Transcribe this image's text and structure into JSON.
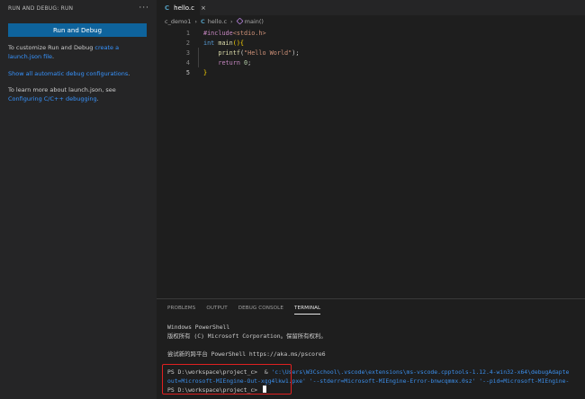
{
  "sidebar": {
    "title": "RUN AND DEBUG: RUN",
    "more_glyph": "···",
    "run_button": "Run and Debug",
    "customize_prefix": "To customize Run and Debug ",
    "customize_link": "create a launch.json file",
    "customize_suffix": ".",
    "show_all_link": "Show all automatic debug configurations",
    "show_all_suffix": ".",
    "learn_prefix": "To learn more about launch.json, see ",
    "learn_link": "Configuring C/C++ debugging",
    "learn_suffix": "."
  },
  "editor": {
    "tab": {
      "icon": "C",
      "label": "hello.c",
      "close": "×"
    },
    "breadcrumb": {
      "folder": "c_demo1",
      "file_icon": "C",
      "file": "hello.c",
      "symbol": "main()"
    },
    "lines": [
      {
        "n": "1",
        "tokens": [
          [
            "t-inc",
            "#include"
          ],
          [
            "t-hdr",
            "<stdio.h>"
          ]
        ]
      },
      {
        "n": "2",
        "tokens": [
          [
            "t-kw",
            "int "
          ],
          [
            "t-fn",
            "main"
          ],
          [
            "t-br",
            "(){"
          ]
        ]
      },
      {
        "n": "3",
        "tokens": [
          [
            "t-pl",
            "    "
          ],
          [
            "t-fn",
            "printf"
          ],
          [
            "t-pl",
            "("
          ],
          [
            "t-str",
            "\"Hello World\""
          ],
          [
            "t-pl",
            ");"
          ]
        ]
      },
      {
        "n": "4",
        "tokens": [
          [
            "t-pl",
            "    "
          ],
          [
            "t-ctl",
            "return "
          ],
          [
            "t-num",
            "0"
          ],
          [
            "t-pl",
            ";"
          ]
        ]
      },
      {
        "n": "5",
        "tokens": [
          [
            "t-br",
            "}"
          ]
        ]
      }
    ]
  },
  "panel": {
    "tabs": [
      "PROBLEMS",
      "OUTPUT",
      "DEBUG CONSOLE",
      "TERMINAL"
    ],
    "active_tab": 3,
    "terminal": {
      "line1": "Windows PowerShell",
      "line2": "版权所有 (C) Microsoft Corporation。保留所有权利。",
      "line3": "尝试新的跨平台 PowerShell https://aka.ms/pscore6",
      "prompt1": "PS D:\\workspace\\project_c>  & ",
      "cmd1": "'c:\\Users\\W3Cschool\\.vscode\\extensions\\ms-vscode.cpptools-1.12.4-win32-x64\\debugAdapte",
      "cmd2": "out=Microsoft-MIEngine-Out-xgg4lkw1.pxe' '--stderr=Microsoft-MIEngine-Error-bnwcqmmx.0sz' '--pid=Microsoft-MIEngine-",
      "prompt2": "PS D:\\workspace\\project_c> "
    }
  }
}
